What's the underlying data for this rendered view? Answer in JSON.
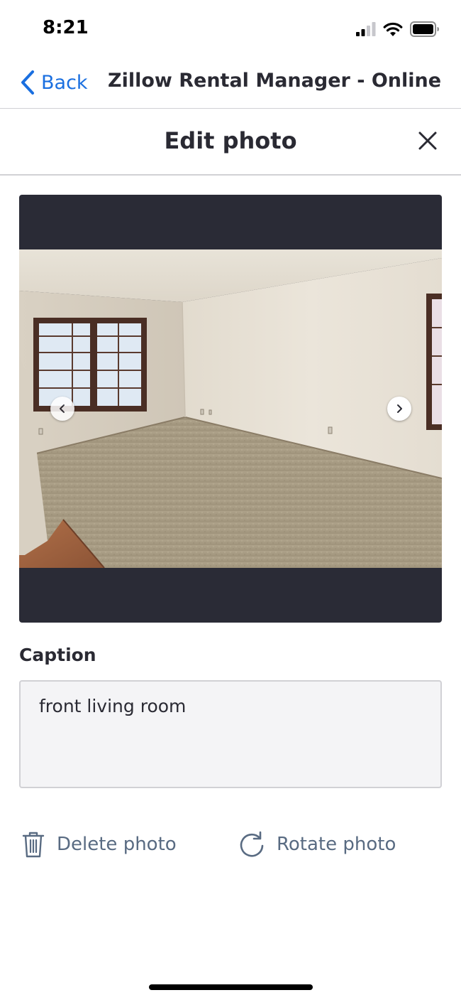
{
  "status_bar": {
    "time": "8:21"
  },
  "nav": {
    "back_label": "Back",
    "title": "Zillow Rental Manager - Online Pr..."
  },
  "modal": {
    "title": "Edit photo"
  },
  "caption": {
    "label": "Caption",
    "value": "front living room"
  },
  "actions": {
    "delete_label": "Delete photo",
    "rotate_label": "Rotate photo"
  },
  "colors": {
    "link_blue": "#1a6fe0",
    "viewer_background": "#2a2b36",
    "action_gray": "#596b82",
    "field_background": "#f4f4f6"
  }
}
